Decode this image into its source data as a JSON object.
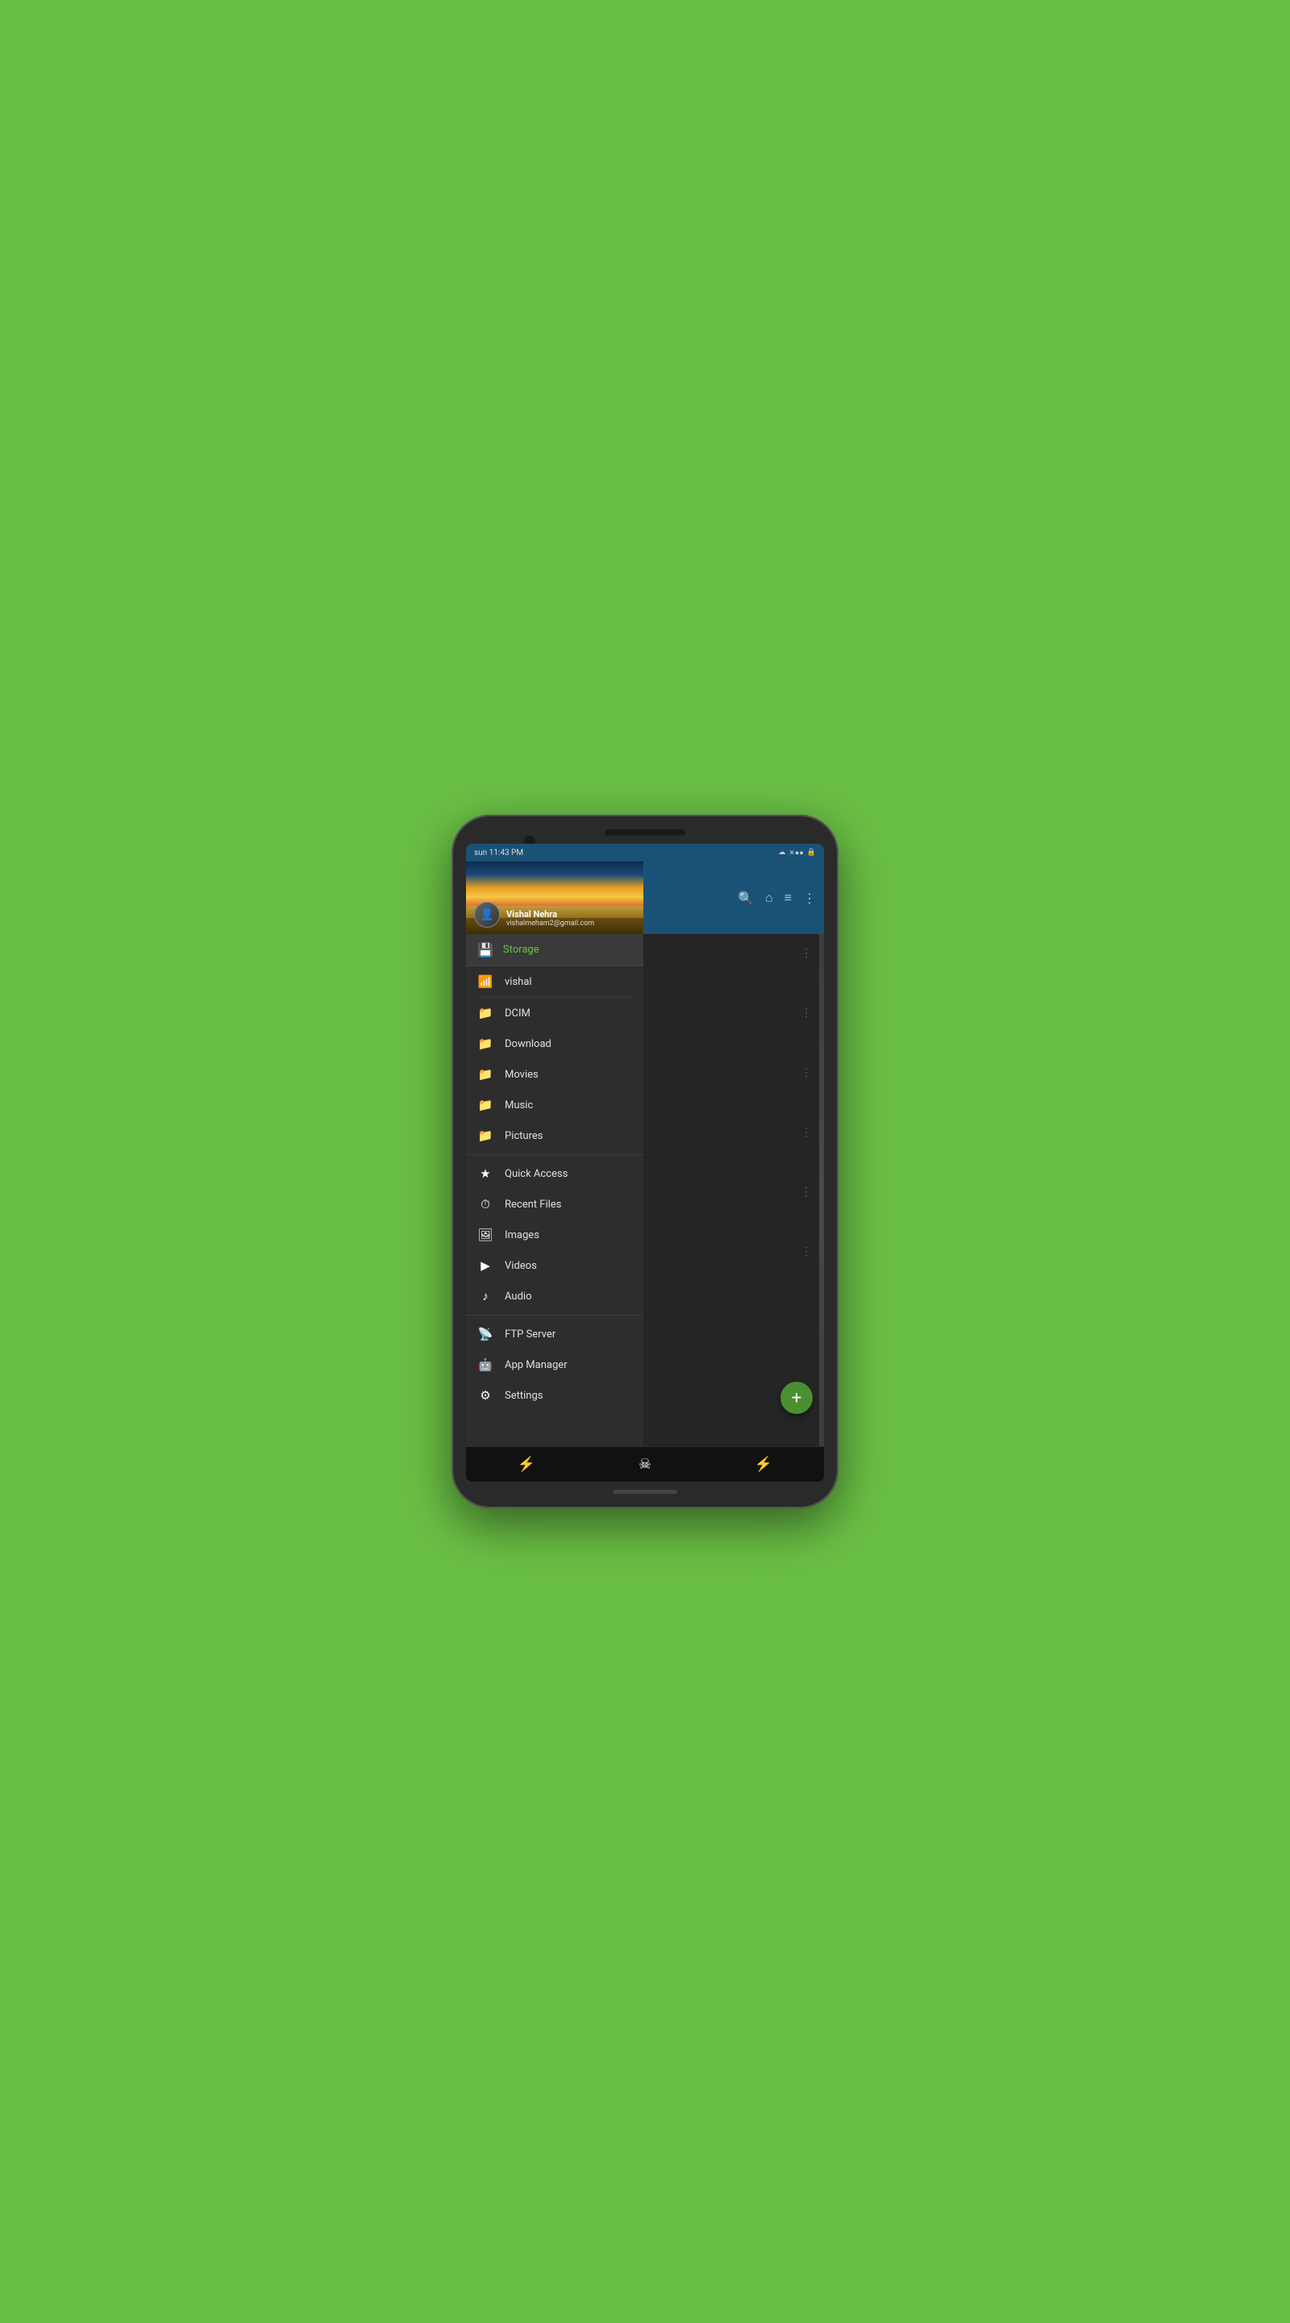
{
  "device": {
    "bg_color": "#6abf45"
  },
  "status_bar": {
    "time": "sun 11:43 PM",
    "icons": [
      "☁",
      "✕●●",
      "🔒"
    ]
  },
  "header": {
    "profile": {
      "name": "Vishal Nehra",
      "email": "vishalmeham2@gmail.com"
    },
    "toolbar_icons": [
      "search",
      "home",
      "filter",
      "more"
    ]
  },
  "sidebar": {
    "storage_label": "Storage",
    "items": [
      {
        "id": "vishal",
        "label": "vishal",
        "icon": "wifi"
      },
      {
        "id": "dcim",
        "label": "DCIM",
        "icon": "folder"
      },
      {
        "id": "download",
        "label": "Download",
        "icon": "folder"
      },
      {
        "id": "movies",
        "label": "Movies",
        "icon": "folder"
      },
      {
        "id": "music-folder",
        "label": "Music",
        "icon": "folder"
      },
      {
        "id": "pictures",
        "label": "Pictures",
        "icon": "folder"
      },
      {
        "id": "quick-access",
        "label": "Quick Access",
        "icon": "star"
      },
      {
        "id": "recent-files",
        "label": "Recent Files",
        "icon": "clock"
      },
      {
        "id": "images",
        "label": "Images",
        "icon": "image"
      },
      {
        "id": "videos",
        "label": "Videos",
        "icon": "play"
      },
      {
        "id": "audio",
        "label": "Audio",
        "icon": "music"
      },
      {
        "id": "ftp-server",
        "label": "FTP Server",
        "icon": "ftp"
      },
      {
        "id": "app-manager",
        "label": "App Manager",
        "icon": "android"
      },
      {
        "id": "settings",
        "label": "Settings",
        "icon": "settings"
      }
    ]
  },
  "content": {
    "dots_count": 6
  },
  "fab": {
    "label": "+"
  },
  "bottom_nav": {
    "icons": [
      "arrow-left",
      "skull",
      "lightning"
    ],
    "active": "skull"
  }
}
